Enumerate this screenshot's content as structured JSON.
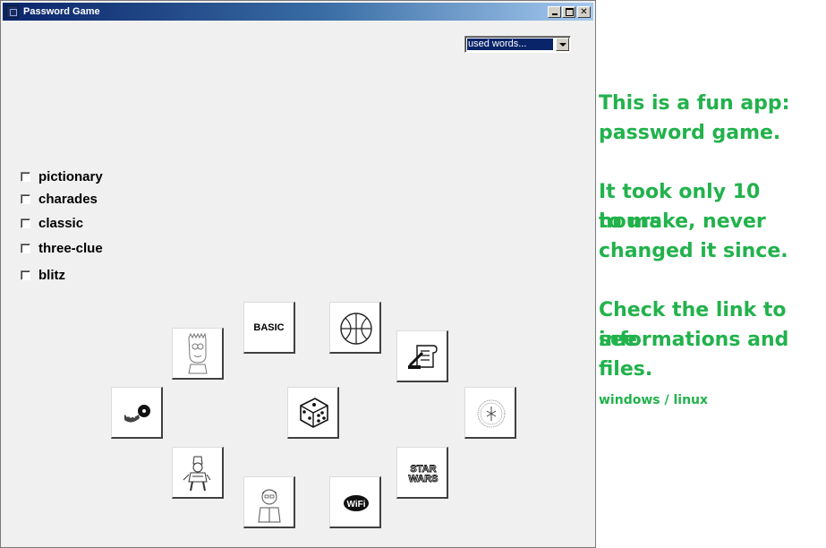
{
  "window": {
    "title": "Password Game"
  },
  "dropdown": {
    "selected": "used words..."
  },
  "game_modes": [
    {
      "label": "pictionary"
    },
    {
      "label": "charades"
    },
    {
      "label": "classic"
    },
    {
      "label": "three-clue"
    },
    {
      "label": "blitz"
    }
  ],
  "tiles": {
    "basic_label": "BASIC",
    "items": [
      {
        "name": "basic-tile",
        "icon": "text-basic"
      },
      {
        "name": "basketball-tile",
        "icon": "basketball-icon"
      },
      {
        "name": "simpsons-tile",
        "icon": "bart-simpson-icon"
      },
      {
        "name": "scroll-tile",
        "icon": "scroll-quill-icon"
      },
      {
        "name": "film-tile",
        "icon": "film-reel-icon"
      },
      {
        "name": "dice-tile",
        "icon": "dice-icon"
      },
      {
        "name": "ring-tile",
        "icon": "ring-inscription-icon"
      },
      {
        "name": "character-tile",
        "icon": "cartoon-character-icon"
      },
      {
        "name": "starwars-tile",
        "icon": "star-wars-logo-icon"
      },
      {
        "name": "person-tile",
        "icon": "cartoon-person-icon"
      },
      {
        "name": "wifi-tile",
        "icon": "wifi-logo-icon"
      }
    ]
  },
  "side_panel": {
    "line1": "This is a fun app:",
    "line2": "password game.",
    "line3": "It took only 10 hours",
    "line4": "to make, never",
    "line5": "changed it since.",
    "line6": "Check the link to see",
    "line7": "informations and files.",
    "platforms": "windows / linux"
  },
  "colors": {
    "accent_green": "#22b24c",
    "titlebar_dark": "#0a246a",
    "selection": "#0a246a"
  }
}
